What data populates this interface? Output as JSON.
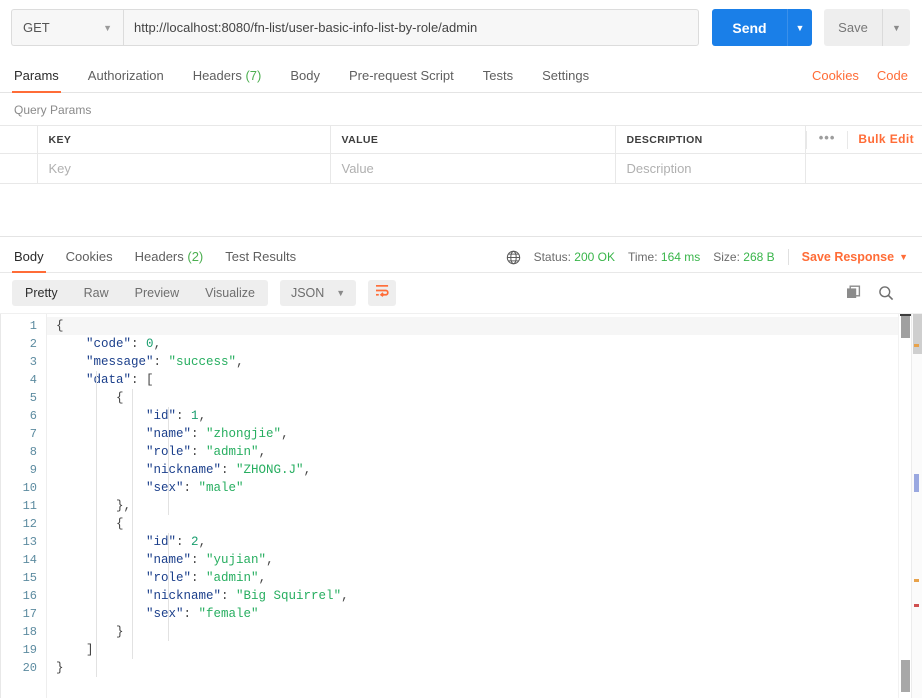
{
  "request": {
    "method": "GET",
    "url": "http://localhost:8080/fn-list/user-basic-info-list-by-role/admin",
    "send_label": "Send",
    "save_label": "Save",
    "caret": "▼"
  },
  "request_tabs": {
    "items": [
      {
        "label": "Params",
        "count": "",
        "active": true
      },
      {
        "label": "Authorization",
        "count": "",
        "active": false
      },
      {
        "label": "Headers",
        "count": "(7)",
        "active": false
      },
      {
        "label": "Body",
        "count": "",
        "active": false
      },
      {
        "label": "Pre-request Script",
        "count": "",
        "active": false
      },
      {
        "label": "Tests",
        "count": "",
        "active": false
      },
      {
        "label": "Settings",
        "count": "",
        "active": false
      }
    ],
    "cookies_label": "Cookies",
    "code_label": "Code"
  },
  "query_params": {
    "title": "Query Params",
    "headers": [
      "KEY",
      "VALUE",
      "DESCRIPTION"
    ],
    "row_placeholders": [
      "Key",
      "Value",
      "Description"
    ],
    "dots": "•••",
    "bulk_edit": "Bulk Edit"
  },
  "response_tabs": {
    "items": [
      {
        "label": "Body",
        "count": "",
        "active": true
      },
      {
        "label": "Cookies",
        "count": "",
        "active": false
      },
      {
        "label": "Headers",
        "count": "(2)",
        "active": false
      },
      {
        "label": "Test Results",
        "count": "",
        "active": false
      }
    ],
    "status_label": "Status:",
    "status_value": "200 OK",
    "time_label": "Time:",
    "time_value": "164 ms",
    "size_label": "Size:",
    "size_value": "268 B",
    "save_response": "Save Response",
    "caret": "▼"
  },
  "view_bar": {
    "segments": [
      {
        "label": "Pretty",
        "active": true
      },
      {
        "label": "Raw",
        "active": false
      },
      {
        "label": "Preview",
        "active": false
      },
      {
        "label": "Visualize",
        "active": false
      }
    ],
    "format": "JSON",
    "caret": "▼"
  },
  "colors": {
    "accent": "#ff6c37",
    "send_blue": "#1a7fe8",
    "status_green": "#39b54a",
    "json_key": "#1b3f8b",
    "json_string": "#27ae60",
    "json_number": "#1a9e6e",
    "gutter_number": "#5c8ba0"
  },
  "response_body": {
    "line_numbers": [
      1,
      2,
      3,
      4,
      5,
      6,
      7,
      8,
      9,
      10,
      11,
      12,
      13,
      14,
      15,
      16,
      17,
      18,
      19,
      20
    ],
    "lines": [
      {
        "indent": 0,
        "tokens": [
          {
            "t": "{",
            "c": "p"
          }
        ]
      },
      {
        "indent": 1,
        "tokens": [
          {
            "t": "\"code\"",
            "c": "k"
          },
          {
            "t": ": ",
            "c": "p"
          },
          {
            "t": "0",
            "c": "n"
          },
          {
            "t": ",",
            "c": "p"
          }
        ]
      },
      {
        "indent": 1,
        "tokens": [
          {
            "t": "\"message\"",
            "c": "k"
          },
          {
            "t": ": ",
            "c": "p"
          },
          {
            "t": "\"success\"",
            "c": "s"
          },
          {
            "t": ",",
            "c": "p"
          }
        ]
      },
      {
        "indent": 1,
        "tokens": [
          {
            "t": "\"data\"",
            "c": "k"
          },
          {
            "t": ": [",
            "c": "p"
          }
        ]
      },
      {
        "indent": 2,
        "tokens": [
          {
            "t": "{",
            "c": "p"
          }
        ]
      },
      {
        "indent": 3,
        "tokens": [
          {
            "t": "\"id\"",
            "c": "k"
          },
          {
            "t": ": ",
            "c": "p"
          },
          {
            "t": "1",
            "c": "n"
          },
          {
            "t": ",",
            "c": "p"
          }
        ]
      },
      {
        "indent": 3,
        "tokens": [
          {
            "t": "\"name\"",
            "c": "k"
          },
          {
            "t": ": ",
            "c": "p"
          },
          {
            "t": "\"zhongjie\"",
            "c": "s"
          },
          {
            "t": ",",
            "c": "p"
          }
        ]
      },
      {
        "indent": 3,
        "tokens": [
          {
            "t": "\"role\"",
            "c": "k"
          },
          {
            "t": ": ",
            "c": "p"
          },
          {
            "t": "\"admin\"",
            "c": "s"
          },
          {
            "t": ",",
            "c": "p"
          }
        ]
      },
      {
        "indent": 3,
        "tokens": [
          {
            "t": "\"nickname\"",
            "c": "k"
          },
          {
            "t": ": ",
            "c": "p"
          },
          {
            "t": "\"ZHONG.J\"",
            "c": "s"
          },
          {
            "t": ",",
            "c": "p"
          }
        ]
      },
      {
        "indent": 3,
        "tokens": [
          {
            "t": "\"sex\"",
            "c": "k"
          },
          {
            "t": ": ",
            "c": "p"
          },
          {
            "t": "\"male\"",
            "c": "s"
          }
        ]
      },
      {
        "indent": 2,
        "tokens": [
          {
            "t": "},",
            "c": "p"
          }
        ]
      },
      {
        "indent": 2,
        "tokens": [
          {
            "t": "{",
            "c": "p"
          }
        ]
      },
      {
        "indent": 3,
        "tokens": [
          {
            "t": "\"id\"",
            "c": "k"
          },
          {
            "t": ": ",
            "c": "p"
          },
          {
            "t": "2",
            "c": "n"
          },
          {
            "t": ",",
            "c": "p"
          }
        ]
      },
      {
        "indent": 3,
        "tokens": [
          {
            "t": "\"name\"",
            "c": "k"
          },
          {
            "t": ": ",
            "c": "p"
          },
          {
            "t": "\"yujian\"",
            "c": "s"
          },
          {
            "t": ",",
            "c": "p"
          }
        ]
      },
      {
        "indent": 3,
        "tokens": [
          {
            "t": "\"role\"",
            "c": "k"
          },
          {
            "t": ": ",
            "c": "p"
          },
          {
            "t": "\"admin\"",
            "c": "s"
          },
          {
            "t": ",",
            "c": "p"
          }
        ]
      },
      {
        "indent": 3,
        "tokens": [
          {
            "t": "\"nickname\"",
            "c": "k"
          },
          {
            "t": ": ",
            "c": "p"
          },
          {
            "t": "\"Big Squirrel\"",
            "c": "s"
          },
          {
            "t": ",",
            "c": "p"
          }
        ]
      },
      {
        "indent": 3,
        "tokens": [
          {
            "t": "\"sex\"",
            "c": "k"
          },
          {
            "t": ": ",
            "c": "p"
          },
          {
            "t": "\"female\"",
            "c": "s"
          }
        ]
      },
      {
        "indent": 2,
        "tokens": [
          {
            "t": "}",
            "c": "p"
          }
        ]
      },
      {
        "indent": 1,
        "tokens": [
          {
            "t": "]",
            "c": "p"
          }
        ]
      },
      {
        "indent": 0,
        "tokens": [
          {
            "t": "}",
            "c": "p"
          }
        ]
      }
    ],
    "parsed": {
      "code": 0,
      "message": "success",
      "data": [
        {
          "id": 1,
          "name": "zhongjie",
          "role": "admin",
          "nickname": "ZHONG.J",
          "sex": "male"
        },
        {
          "id": 2,
          "name": "yujian",
          "role": "admin",
          "nickname": "Big Squirrel",
          "sex": "female"
        }
      ]
    }
  }
}
